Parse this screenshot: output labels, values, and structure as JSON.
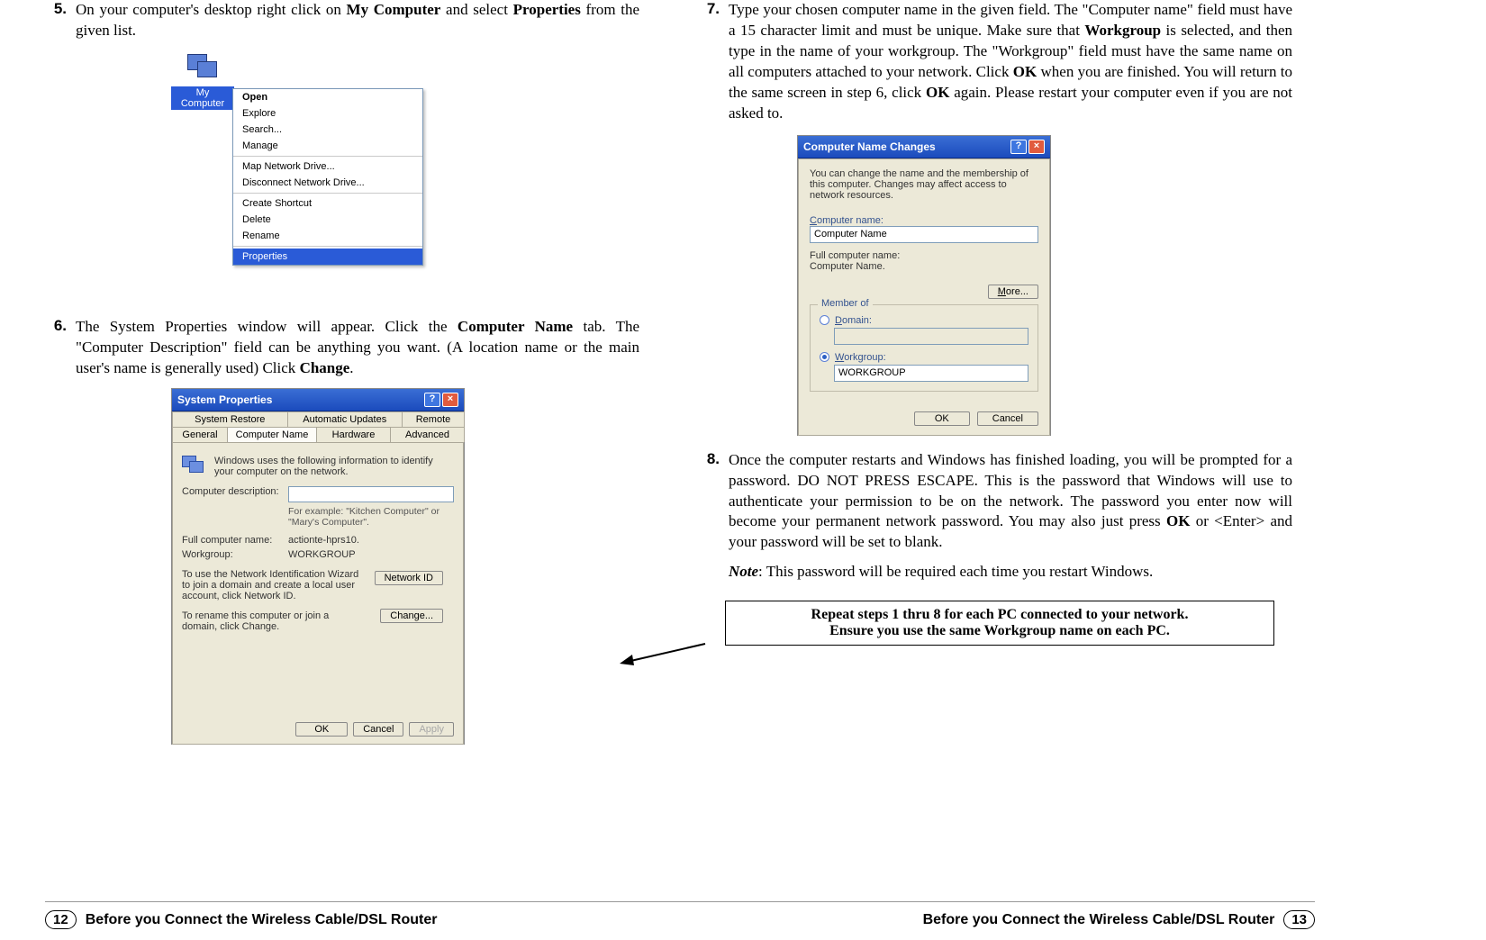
{
  "left": {
    "step5_num": "5.",
    "step5_a": "On your computer's desktop right click on ",
    "step5_b": "My Computer",
    "step5_c": " and select  ",
    "step5_d": "Properties",
    "step5_e": " from the given list.",
    "mycomputer_label": "My Computer",
    "ctx": {
      "open": "Open",
      "explore": "Explore",
      "search": "Search...",
      "manage": "Manage",
      "map": "Map Network Drive...",
      "disconnect": "Disconnect Network Drive...",
      "shortcut": "Create Shortcut",
      "delete": "Delete",
      "rename": "Rename",
      "properties": "Properties"
    },
    "step6_num": "6.",
    "step6_a": "The System Properties window will appear. Click the ",
    "step6_b": "Computer Name",
    "step6_c": " tab. The \"Computer Description\" field can be anything you want. (A location name or the main user's name is generally used) Click ",
    "step6_d": "Change",
    "step6_e": ".",
    "sysprops": {
      "title": "System Properties",
      "tabs_row1": {
        "a": "System Restore",
        "b": "Automatic Updates",
        "c": "Remote"
      },
      "tabs_row2": {
        "a": "General",
        "b": "Computer Name",
        "c": "Hardware",
        "d": "Advanced"
      },
      "intro": "Windows uses the following information to identify your computer on the network.",
      "desc_lbl": "Computer description:",
      "desc_hint": "For example: \"Kitchen Computer\" or \"Mary's Computer\".",
      "full_lbl": "Full computer name:",
      "full_val": "actionte-hprs10.",
      "wg_lbl": "Workgroup:",
      "wg_val": "WORKGROUP",
      "net_text": "To use the Network Identification Wizard to join a domain and create a local user account, click Network ID.",
      "netid_btn": "Network ID",
      "change_text": "To rename this computer or join a domain, click Change.",
      "change_btn": "Change...",
      "ok": "OK",
      "cancel": "Cancel",
      "apply": "Apply"
    }
  },
  "right": {
    "step7_num": "7.",
    "step7_a": "Type your chosen computer name in the given field. The \"Computer name\" field must have a 15 character limit and must be unique. Make sure that ",
    "step7_b": "Workgroup",
    "step7_c": " is selected, and then type in the name of your workgroup. The \"Workgroup\" field must have the same name on all computers attached to your network. Click ",
    "step7_d": "OK",
    "step7_e": " when you are finished. You will return to the same screen in step 6, click ",
    "step7_f": "OK",
    "step7_g": " again. Please restart your computer even if you are not asked to.",
    "cnc": {
      "title": "Computer Name Changes",
      "intro": "You can change the name and the membership of this computer. Changes may affect access to network resources.",
      "name_lbl_pre": "C",
      "name_lbl_post": "omputer name:",
      "name_val": "Computer Name",
      "full_lbl": "Full computer name:",
      "full_val": "Computer Name.",
      "more_pre": "M",
      "more_post": "ore...",
      "memberof": "Member of",
      "domain_pre": "D",
      "domain_post": "omain:",
      "wg_pre": "W",
      "wg_post": "orkgroup:",
      "wg_val": "WORKGROUP",
      "ok": "OK",
      "cancel": "Cancel"
    },
    "step8_num": "8.",
    "step8_a": "Once the computer restarts and Windows has finished loading, you will be prompted for a password. DO NOT PRESS ESCAPE. This is the password that Windows will use to authenticate your permission to be on the network. The password you enter now will become your permanent network password. You may also just press ",
    "step8_b": "OK",
    "step8_c": " or <Enter> and your password will be set to blank.",
    "note_a": "Note",
    "note_b": ": This password will be required each time you restart Windows.",
    "callout1": "Repeat steps 1 thru 8 for each PC connected to your network.",
    "callout2": "Ensure you use the same Workgroup name on each PC."
  },
  "footer": {
    "left_num": "12",
    "right_num": "13",
    "text": "Before you Connect the Wireless Cable/DSL Router"
  }
}
